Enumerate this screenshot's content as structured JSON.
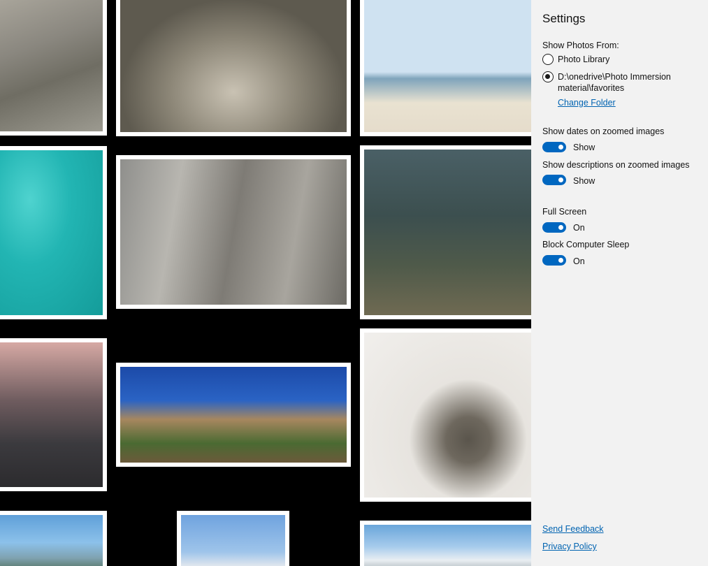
{
  "settings": {
    "title": "Settings",
    "show_photos_from_label": "Show Photos From:",
    "source_options": [
      {
        "label": "Photo Library",
        "selected": false
      },
      {
        "label_line1": "D:\\onedrive\\Photo Immersion",
        "label_line2": "material\\favorites",
        "selected": true
      }
    ],
    "change_folder_label": "Change Folder",
    "show_dates_label": "Show dates on zoomed images",
    "show_dates_value": "Show",
    "show_descriptions_label": "Show descriptions on zoomed images",
    "show_descriptions_value": "Show",
    "full_screen_label": "Full Screen",
    "full_screen_value": "On",
    "block_sleep_label": "Block Computer Sleep",
    "block_sleep_value": "On",
    "send_feedback_label": "Send Feedback",
    "privacy_policy_label": "Privacy Policy"
  },
  "colors": {
    "accent": "#0067c0",
    "link": "#0063b1",
    "pane_background": "#f2f2f2",
    "gallery_background": "#000000"
  }
}
